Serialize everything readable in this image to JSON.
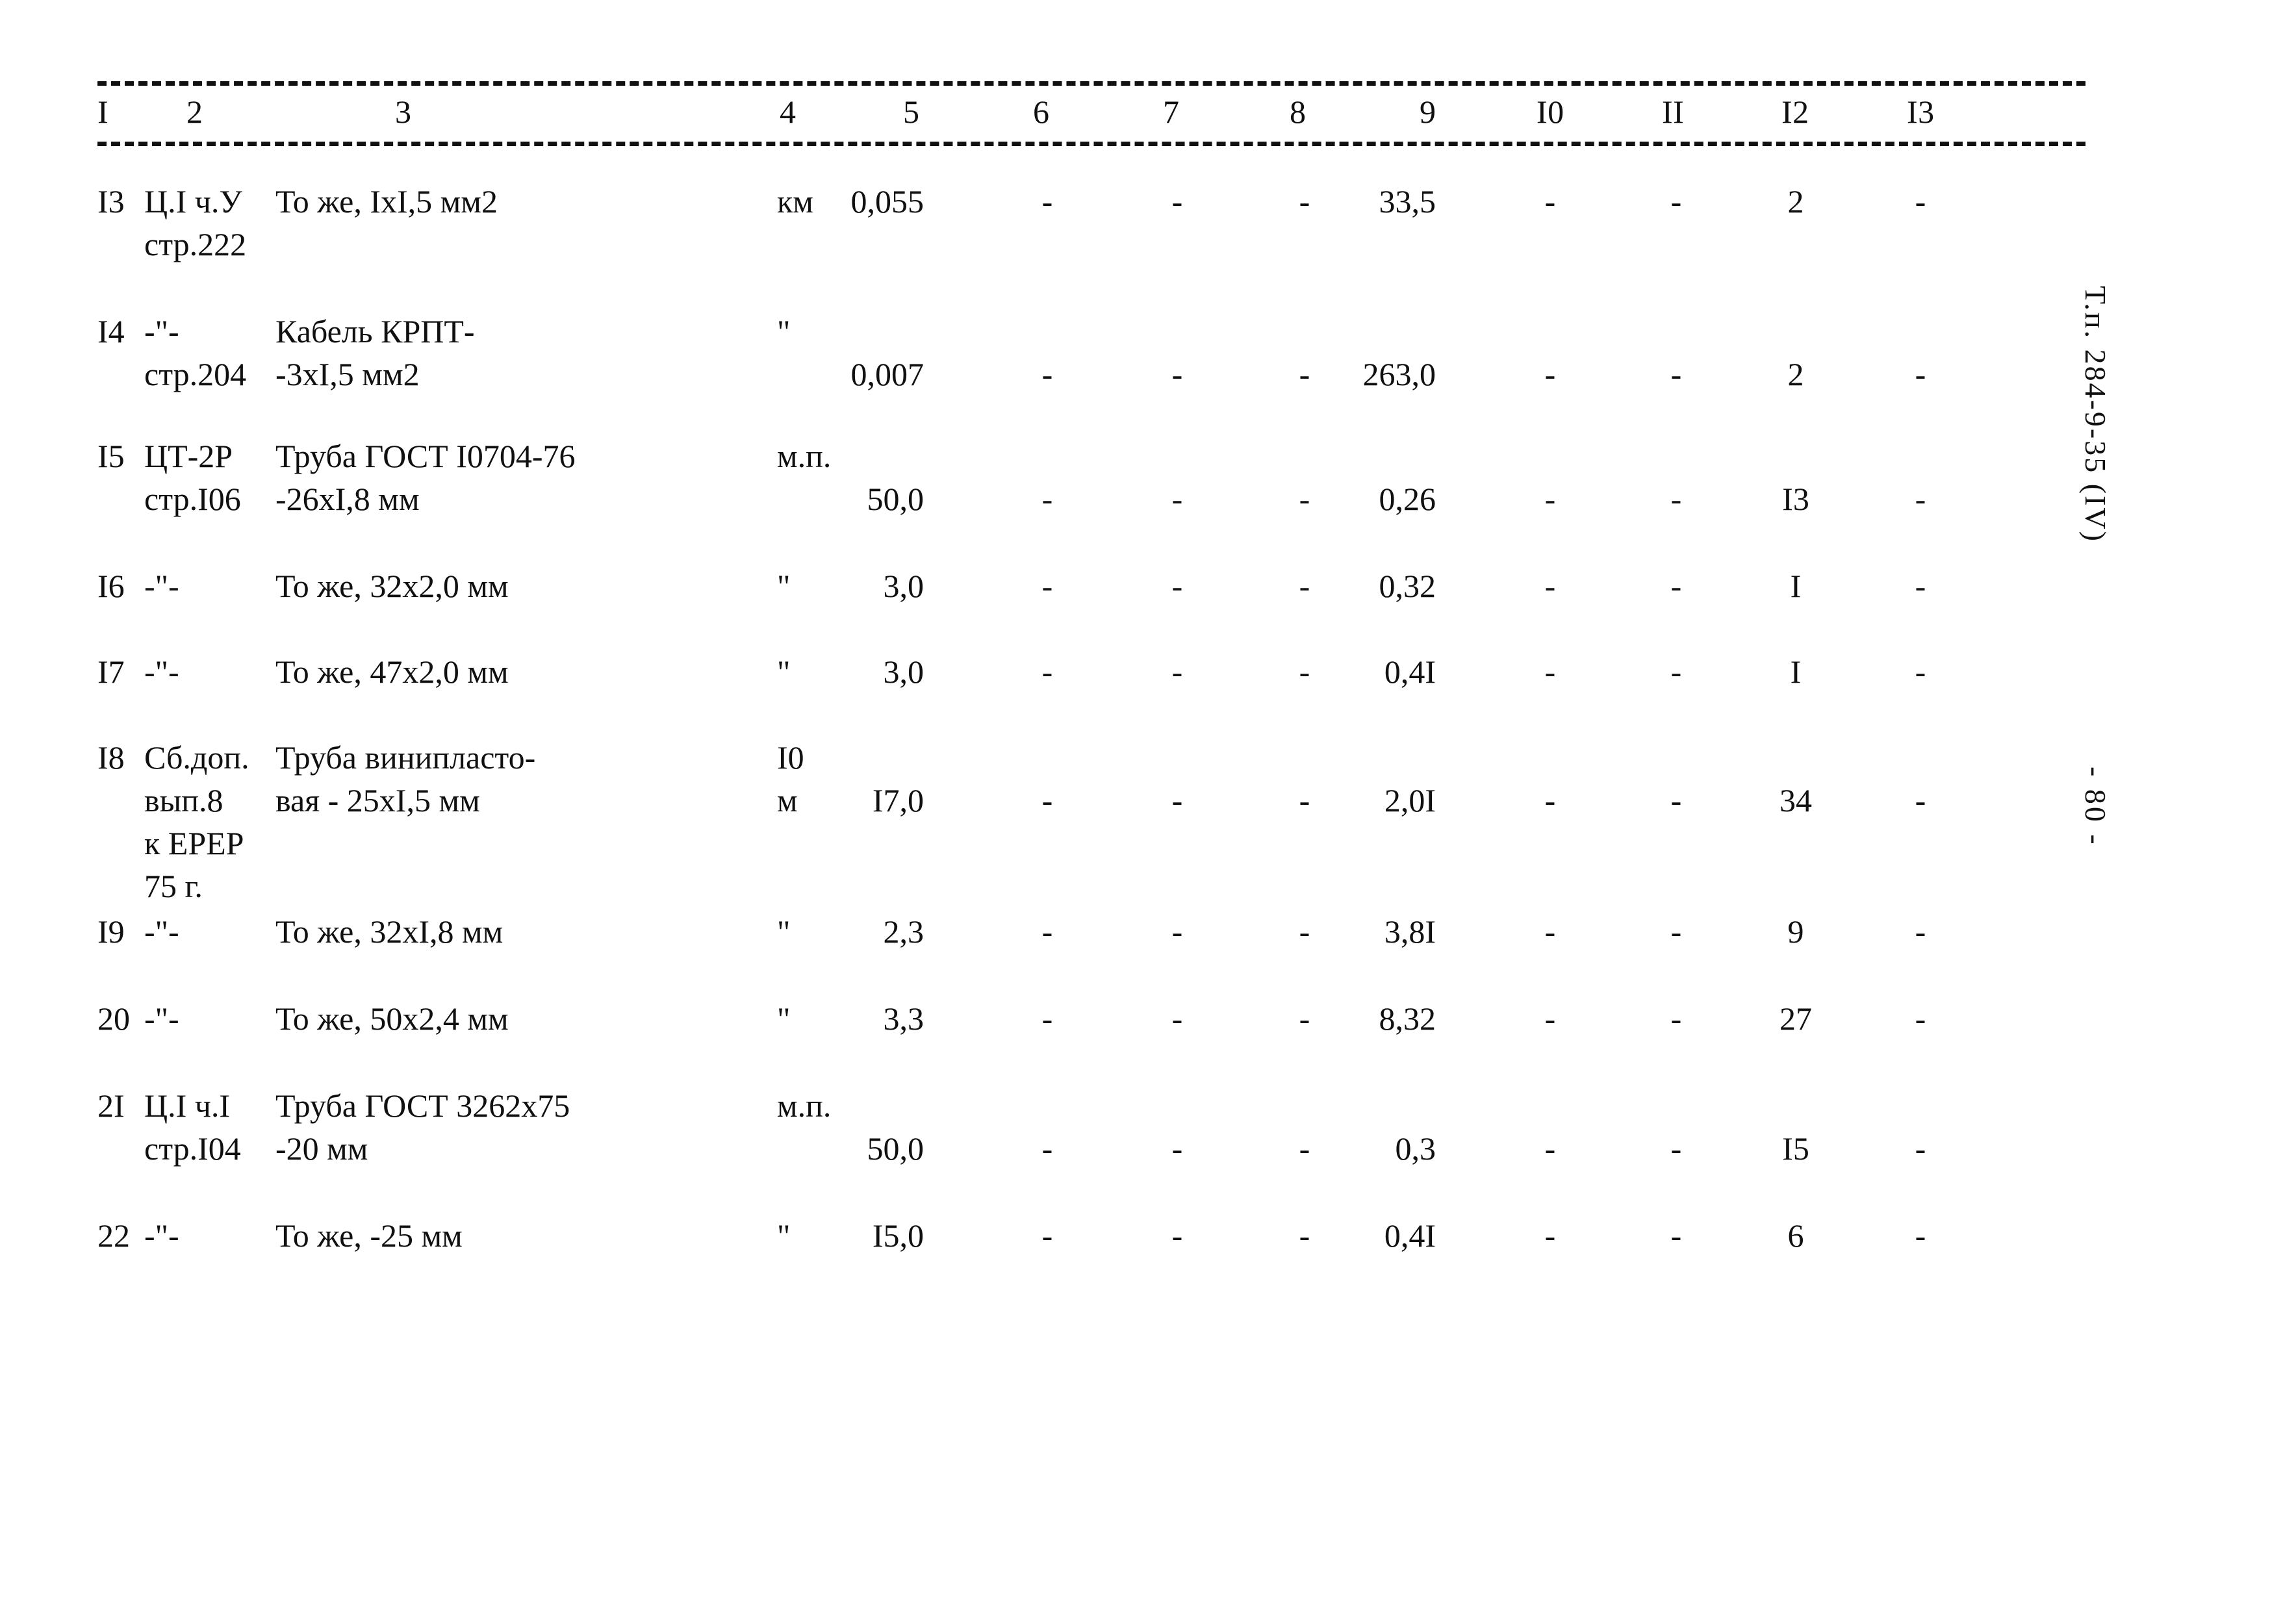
{
  "document": {
    "type": "typewritten-table",
    "language": "ru",
    "page_marker": "- 80 -",
    "doc_code": "Т.п. 284-9-35  (IV)"
  },
  "table": {
    "column_headers": [
      "I",
      "2",
      "3",
      "4",
      "5",
      "6",
      "7",
      "8",
      "9",
      "I0",
      "II",
      "I2",
      "I3"
    ],
    "rows": [
      {
        "num": "I3",
        "ref": [
          "Ц.I ч.У",
          "стр.222"
        ],
        "name": [
          "То же, IxI,5 мм2"
        ],
        "unit": [
          "км"
        ],
        "c5": "0,055",
        "c6": "-",
        "c7": "-",
        "c8": "-",
        "c9": "33,5",
        "c10": "-",
        "c11": "-",
        "c12": "2",
        "c13": "-"
      },
      {
        "num": "I4",
        "ref": [
          "-\"-",
          "стр.204"
        ],
        "name": [
          "Кабель КРПТ-",
          "-3xI,5 мм2"
        ],
        "unit": [
          "\""
        ],
        "c5": "0,007",
        "c6": "-",
        "c7": "-",
        "c8": "-",
        "c9": "263,0",
        "c10": "-",
        "c11": "-",
        "c12": "2",
        "c13": "-"
      },
      {
        "num": "I5",
        "ref": [
          "ЦТ-2Р",
          "стр.I06"
        ],
        "name": [
          "Труба ГОСТ I0704-76",
          "-26xI,8 мм"
        ],
        "unit": [
          "м.п."
        ],
        "c5": "50,0",
        "c6": "-",
        "c7": "-",
        "c8": "-",
        "c9": "0,26",
        "c10": "-",
        "c11": "-",
        "c12": "I3",
        "c13": "-"
      },
      {
        "num": "I6",
        "ref": [
          "-\"-"
        ],
        "name": [
          "То же, 32x2,0 мм"
        ],
        "unit": [
          "\""
        ],
        "c5": "3,0",
        "c6": "-",
        "c7": "-",
        "c8": "-",
        "c9": "0,32",
        "c10": "-",
        "c11": "-",
        "c12": "I",
        "c13": "-"
      },
      {
        "num": "I7",
        "ref": [
          "-\"-"
        ],
        "name": [
          "То же, 47x2,0 мм"
        ],
        "unit": [
          "\""
        ],
        "c5": "3,0",
        "c6": "-",
        "c7": "-",
        "c8": "-",
        "c9": "0,4I",
        "c10": "-",
        "c11": "-",
        "c12": "I",
        "c13": "-"
      },
      {
        "num": "I8",
        "ref": [
          "Сб.доп.",
          "вып.8",
          "к ЕРЕР",
          "75 г."
        ],
        "name": [
          "Труба винипласто-",
          "вая - 25xI,5 мм"
        ],
        "unit": [
          "I0",
          "м"
        ],
        "c5": "I7,0",
        "c6": "-",
        "c7": "-",
        "c8": "-",
        "c9": "2,0I",
        "c10": "-",
        "c11": "-",
        "c12": "34",
        "c13": "-"
      },
      {
        "num": "I9",
        "ref": [
          "-\"-"
        ],
        "name": [
          "То же, 32xI,8 мм"
        ],
        "unit": [
          "\""
        ],
        "c5": "2,3",
        "c6": "-",
        "c7": "-",
        "c8": "-",
        "c9": "3,8I",
        "c10": "-",
        "c11": "-",
        "c12": "9",
        "c13": "-"
      },
      {
        "num": "20",
        "ref": [
          "-\"-"
        ],
        "name": [
          "То же, 50x2,4 мм"
        ],
        "unit": [
          "\""
        ],
        "c5": "3,3",
        "c6": "-",
        "c7": "-",
        "c8": "-",
        "c9": "8,32",
        "c10": "-",
        "c11": "-",
        "c12": "27",
        "c13": "-"
      },
      {
        "num": "2I",
        "ref": [
          "Ц.I ч.I",
          "стр.I04"
        ],
        "name": [
          "Труба ГОСТ 3262x75",
          "-20 мм"
        ],
        "unit": [
          "м.п."
        ],
        "c5": "50,0",
        "c6": "-",
        "c7": "-",
        "c8": "-",
        "c9": "0,3",
        "c10": "-",
        "c11": "-",
        "c12": "I5",
        "c13": "-"
      },
      {
        "num": "22",
        "ref": [
          "-\"-"
        ],
        "name": [
          "То же, -25 мм"
        ],
        "unit": [
          "\""
        ],
        "c5": "I5,0",
        "c6": "-",
        "c7": "-",
        "c8": "-",
        "c9": "0,4I",
        "c10": "-",
        "c11": "-",
        "c12": "6",
        "c13": "-"
      }
    ]
  }
}
